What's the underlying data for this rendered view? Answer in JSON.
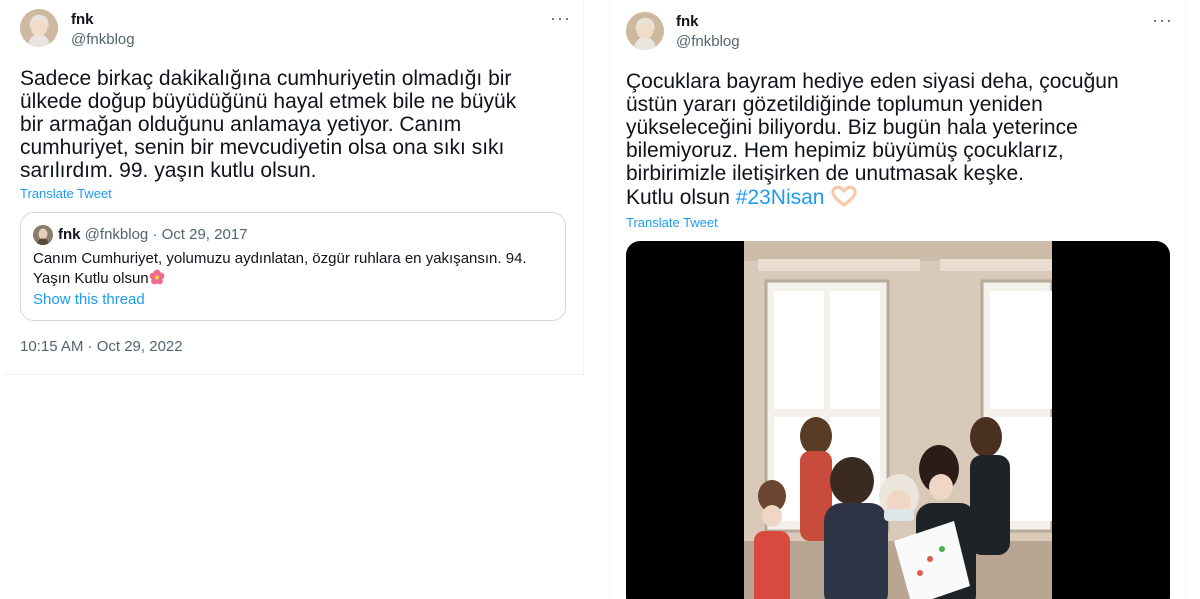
{
  "left_tweet": {
    "author_name": "fnk",
    "author_handle": "@fnkblog",
    "more_icon": "more-horizontal-icon",
    "text_lines": [
      "Sadece birkaç dakikalığına cumhuriyetin olmadığı bir",
      "ülkede doğup büyüdüğünü hayal etmek bile ne büyük",
      "bir armağan olduğunu anlamaya yetiyor. Canım",
      "cumhuriyet, senin bir mevcudiyetin olsa ona sıkı sıkı",
      "sarılırdım. 99. yaşın kutlu olsun."
    ],
    "translate_label": "Translate Tweet",
    "quote": {
      "author_name": "fnk",
      "author_handle": "@fnkblog",
      "separator": "·",
      "date": "Oct 29, 2017",
      "text_line1": "Canım Cumhuriyet, yolumuzu aydınlatan, özgür ruhlara en yakışansın. 94.",
      "text_line2": "Yaşın Kutlu olsun",
      "emoji_icon": "hibiscus-flower-icon",
      "show_thread_label": "Show this thread"
    },
    "timestamp": "10:15 AM · Oct 29, 2022"
  },
  "right_tweet": {
    "author_name": "fnk",
    "author_handle": "@fnkblog",
    "more_icon": "more-horizontal-icon",
    "text_lines": [
      "Çocuklara bayram hediye eden siyasi deha, çocuğun",
      "üstün yararı gözetildiğinde toplumun yeniden",
      "yükseleceğini biliyordu. Biz bugün hala yeterince",
      "bilemiyoruz. Hem hepimiz büyümüş çocuklarız,",
      "birbirimizle iletişirken de unutmasak keşke."
    ],
    "last_line_prefix": "Kutlu olsun ",
    "hashtag": "#23Nisan",
    "emoji_icon": "heart-hands-icon",
    "translate_label": "Translate Tweet",
    "media_icon": "video-thumbnail"
  },
  "colors": {
    "text": "#0f1419",
    "secondary": "#536471",
    "link": "#1d9bf0",
    "border": "#cfd9de"
  }
}
